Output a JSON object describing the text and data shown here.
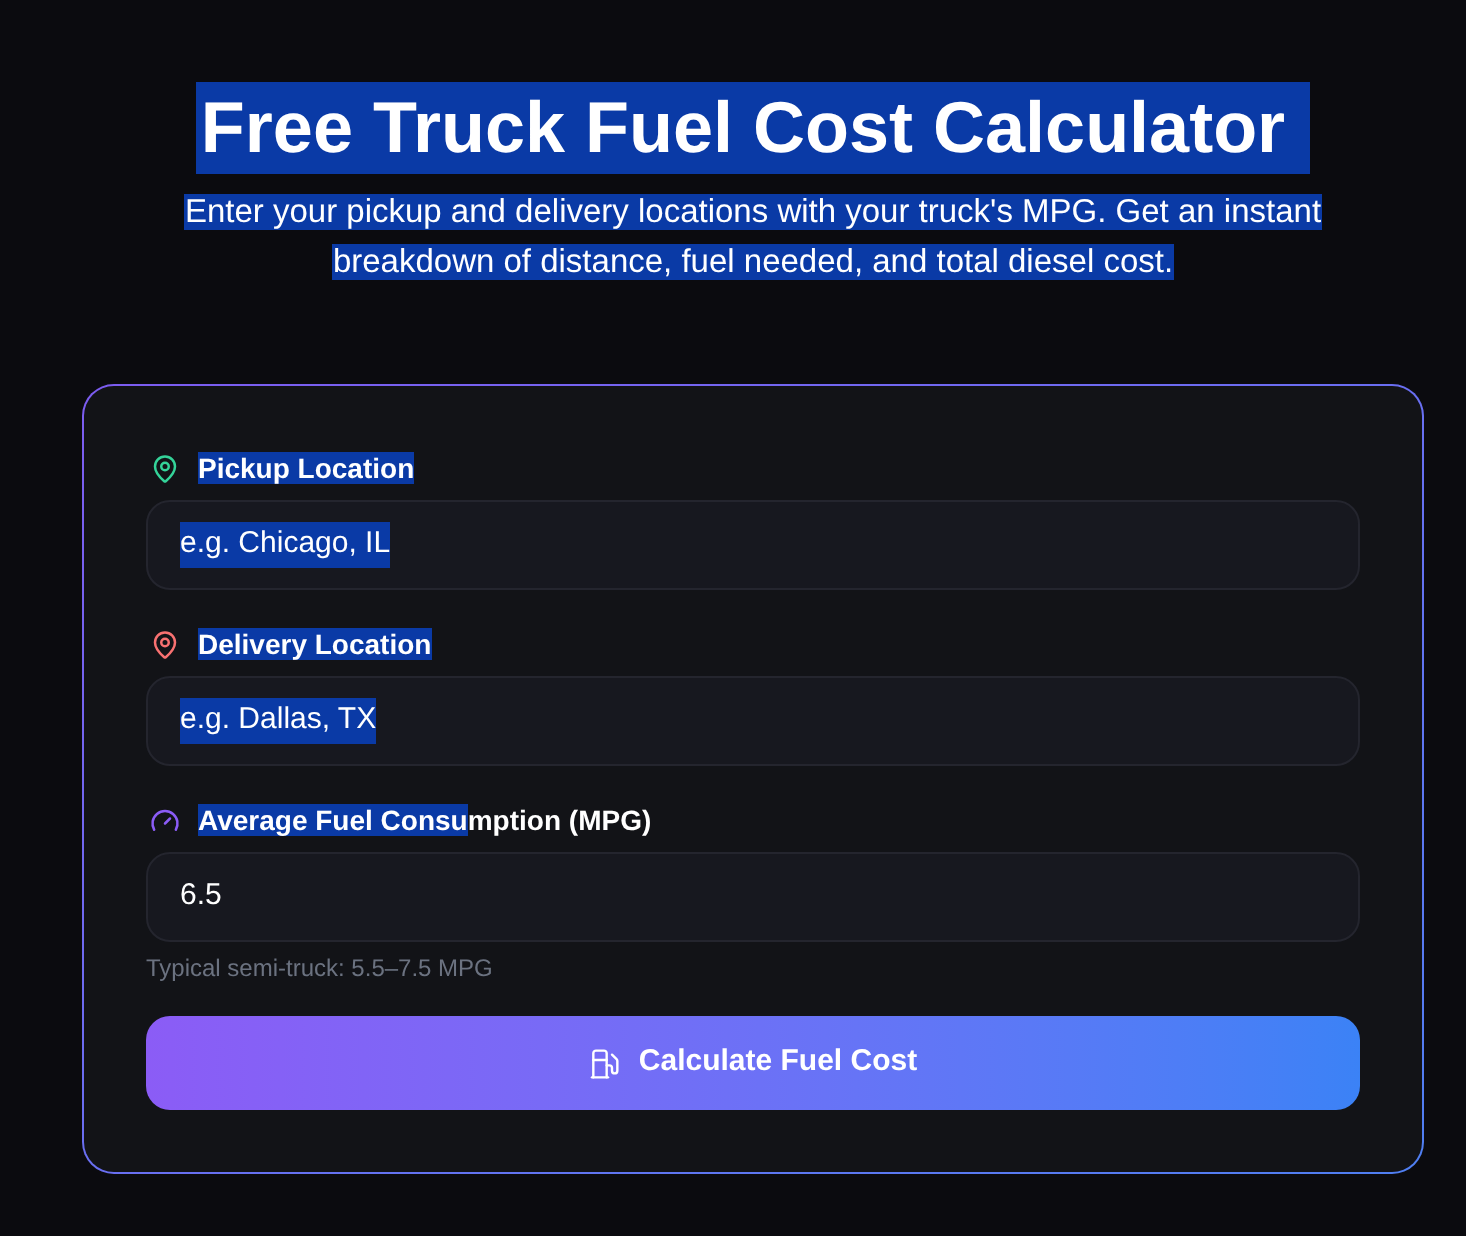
{
  "header": {
    "title": {
      "text": "Free Truck Fuel Cost Calculator",
      "highlighted": true
    },
    "subtitle": {
      "text": "Enter your pickup and delivery locations with your truck's MPG. Get an instant breakdown of distance, fuel needed, and total diesel cost.",
      "highlighted": true
    }
  },
  "form": {
    "fields": [
      {
        "kind": "location",
        "color": "#34d399",
        "label_parts": [
          {
            "text": "Pickup Location",
            "highlighted": true
          }
        ],
        "placeholder": "e.g. Chicago, IL",
        "placeholder_highlighted": true
      },
      {
        "kind": "location",
        "color": "#f87171",
        "label_parts": [
          {
            "text": "Delivery Location",
            "highlighted": true
          }
        ],
        "placeholder": "e.g. Dallas, TX",
        "placeholder_highlighted": true
      },
      {
        "kind": "gauge",
        "color": "#8b5cf6",
        "label_parts": [
          {
            "text": "Average Fuel Consu",
            "highlighted": true
          },
          {
            "text": "mption (MPG)",
            "highlighted": false
          }
        ],
        "value": "6.5",
        "hint": "Typical semi-truck: 5.5–7.5 MPG"
      }
    ],
    "submit_button": {
      "label": "Calculate Fuel Cost"
    }
  }
}
